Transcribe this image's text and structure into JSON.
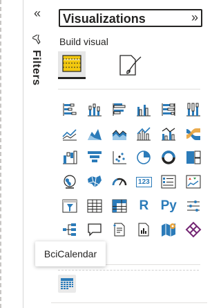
{
  "filters": {
    "label": "Filters"
  },
  "visualizations": {
    "title": "Visualizations"
  },
  "build_visual": {
    "label": "Build visual"
  },
  "tooltip": {
    "text": "BciCalendar"
  },
  "colors": {
    "accent_blue": "#2b7bb9",
    "accent_orange": "#e8a23a",
    "gold": "#f2c80f"
  },
  "visual_icons": [
    "stacked-bar-chart-icon",
    "stacked-column-chart-icon",
    "clustered-bar-chart-icon",
    "clustered-column-chart-icon",
    "100-stacked-bar-chart-icon",
    "100-stacked-column-chart-icon",
    "line-chart-icon",
    "area-chart-icon",
    "stacked-area-chart-icon",
    "line-and-stacked-column-chart-icon",
    "line-and-clustered-column-chart-icon",
    "ribbon-chart-icon",
    "waterfall-chart-icon",
    "funnel-chart-icon",
    "scatter-chart-icon",
    "pie-chart-icon",
    "donut-chart-icon",
    "treemap-icon",
    "map-icon",
    "filled-map-icon",
    "gauge-icon",
    "card-icon",
    "multi-row-card-icon",
    "kpi-icon",
    "slicer-icon",
    "table-icon",
    "matrix-icon",
    "r-script-visual-icon",
    "python-visual-icon",
    "key-influencers-icon",
    "decomposition-tree-icon",
    "qa-icon",
    "smart-narrative-icon",
    "paginated-report-icon",
    "azure-map-icon",
    "power-apps-icon"
  ],
  "card_text": "123",
  "r_text": "R",
  "py_text": "Py",
  "custom_visual": {
    "name": "calendar-icon"
  }
}
